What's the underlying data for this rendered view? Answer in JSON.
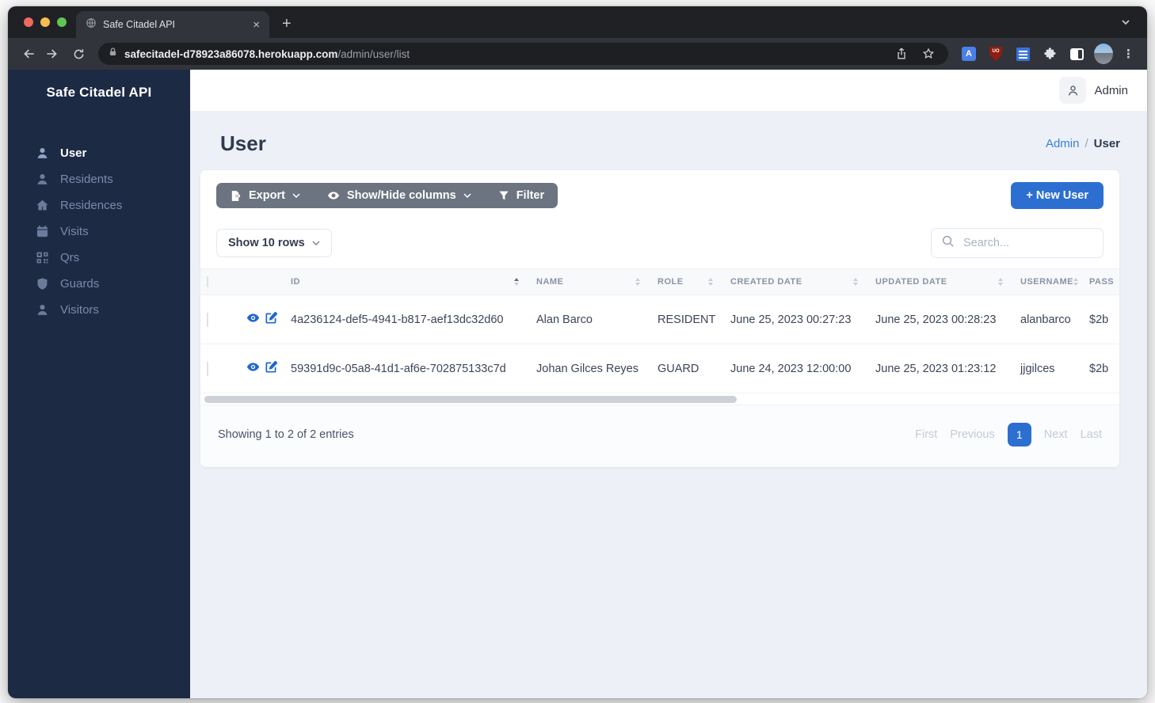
{
  "browser": {
    "tab_title": "Safe Citadel API",
    "close_glyph": "×",
    "new_tab_glyph": "+",
    "url_domain": "safecitadel-d78923a86078.herokuapp.com",
    "url_path": "/admin/user/list",
    "menu_glyph": "⋮",
    "ublock_label": "UO",
    "translate_label": "A"
  },
  "sidebar": {
    "brand": "Safe Citadel API",
    "items": [
      {
        "label": "User",
        "icon": "user-icon",
        "active": true
      },
      {
        "label": "Residents",
        "icon": "user-icon",
        "active": false
      },
      {
        "label": "Residences",
        "icon": "home-icon",
        "active": false
      },
      {
        "label": "Visits",
        "icon": "calendar-icon",
        "active": false
      },
      {
        "label": "Qrs",
        "icon": "qr-icon",
        "active": false
      },
      {
        "label": "Guards",
        "icon": "shield-icon",
        "active": false
      },
      {
        "label": "Visitors",
        "icon": "user-icon",
        "active": false
      }
    ]
  },
  "header": {
    "user_label": "Admin"
  },
  "page": {
    "title": "User",
    "breadcrumb_parent": "Admin",
    "breadcrumb_sep": "/",
    "breadcrumb_current": "User"
  },
  "toolbar": {
    "export_label": "Export",
    "columns_label": "Show/Hide columns",
    "filter_label": "Filter",
    "new_user_label": "+ New User",
    "show_rows_label": "Show 10 rows",
    "search_placeholder": "Search..."
  },
  "table": {
    "headers": {
      "id": "ID",
      "name": "NAME",
      "role": "ROLE",
      "created": "CREATED DATE",
      "updated": "UPDATED DATE",
      "username": "USERNAME",
      "password": "PASS"
    },
    "rows": [
      {
        "id": "4a236124-def5-4941-b817-aef13dc32d60",
        "name": "Alan Barco",
        "role": "RESIDENT",
        "created": "June 25, 2023 00:27:23",
        "updated": "June 25, 2023 00:28:23",
        "username": "alanbarco",
        "password": "$2b"
      },
      {
        "id": "59391d9c-05a8-41d1-af6e-702875133c7d",
        "name": "Johan Gilces Reyes",
        "role": "GUARD",
        "created": "June 24, 2023 12:00:00",
        "updated": "June 25, 2023 01:23:12",
        "username": "jjgilces",
        "password": "$2b"
      }
    ]
  },
  "footer": {
    "summary": "Showing 1 to 2 of 2 entries",
    "first": "First",
    "previous": "Previous",
    "page": "1",
    "next": "Next",
    "last": "Last"
  },
  "colors": {
    "accent_blue": "#2c6fd1",
    "link_blue": "#3b7ddd",
    "sidebar_bg": "#1d2a44",
    "button_group_gray": "#6c7481",
    "action_icon_blue": "#2166d2"
  }
}
